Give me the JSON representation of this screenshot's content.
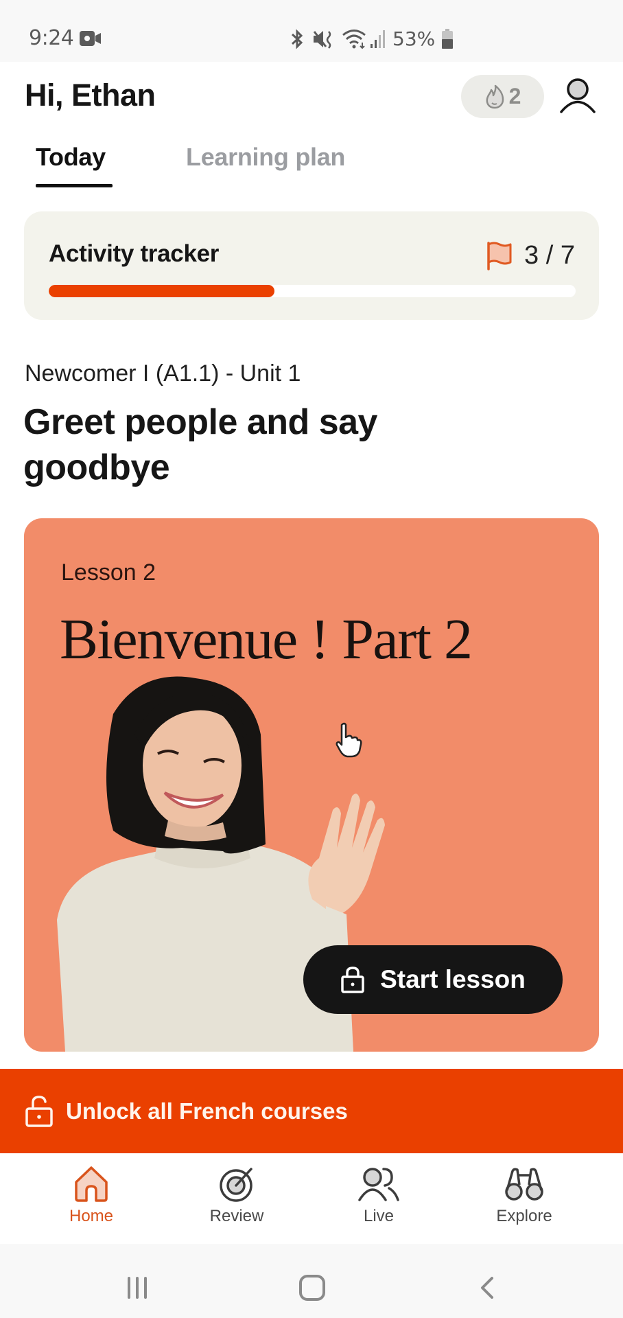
{
  "status_bar": {
    "time": "9:24",
    "battery": "53%",
    "icons": [
      "video-recording-icon",
      "bluetooth-icon",
      "mute-vibrate-icon",
      "wifi-icon",
      "signal-icon",
      "battery-icon"
    ]
  },
  "header": {
    "greeting": "Hi, Ethan",
    "streak_count": "2",
    "streak_icon": "flame-icon",
    "profile_icon": "profile-icon"
  },
  "tabs": [
    {
      "label": "Today",
      "active": true
    },
    {
      "label": "Learning plan",
      "active": false
    }
  ],
  "activity_tracker": {
    "title": "Activity tracker",
    "count": "3 / 7",
    "completed": 3,
    "total": 7,
    "progress_fraction": 0.4286,
    "icon": "flag-icon"
  },
  "unit": {
    "subtitle": "Newcomer I (A1.1) - Unit 1",
    "title": "Greet people and say goodbye"
  },
  "lesson_card": {
    "lesson_number": "Lesson 2",
    "title": "Bienvenue ! Part 2",
    "button_label": "Start lesson",
    "button_icon": "lock-icon",
    "image": "woman-waving-illustration"
  },
  "banner": {
    "label": "Unlock all French courses",
    "icon": "unlock-icon"
  },
  "bottom_nav": [
    {
      "label": "Home",
      "icon": "home-icon",
      "active": true
    },
    {
      "label": "Review",
      "icon": "target-icon",
      "active": false
    },
    {
      "label": "Live",
      "icon": "people-icon",
      "active": false
    },
    {
      "label": "Explore",
      "icon": "binoculars-icon",
      "active": false
    }
  ],
  "system_nav": [
    "recents-button",
    "home-button",
    "back-button"
  ],
  "colors": {
    "accent": "#ea4000",
    "lesson_card_bg": "#f28c69",
    "tracker_bg": "#f3f3ec",
    "active_nav": "#d9541c",
    "inactive_tab": "#9b9da1"
  }
}
